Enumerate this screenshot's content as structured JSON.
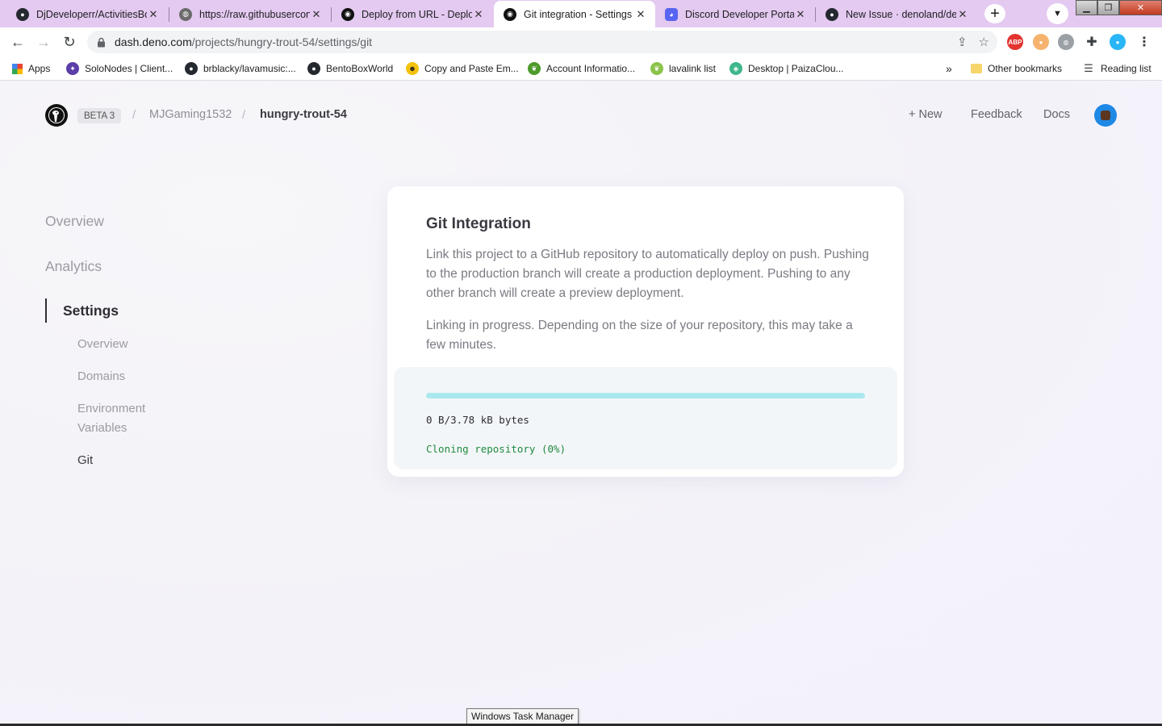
{
  "browser": {
    "tabs": [
      {
        "title": "DjDeveloperr/ActivitiesBo",
        "icon": "github-icon"
      },
      {
        "title": "https://raw.githubusercon",
        "icon": "globe-icon"
      },
      {
        "title": "Deploy from URL - Deplo",
        "icon": "deno-icon"
      },
      {
        "title": "Git integration - Settings",
        "icon": "deno-icon",
        "active": true
      },
      {
        "title": "Discord Developer Portal",
        "icon": "discord-icon"
      },
      {
        "title": "New Issue · denoland/der",
        "icon": "github-icon"
      }
    ],
    "url_domain": "dash.deno.com",
    "url_path": "/projects/hungry-trout-54/settings/git",
    "bookmarks": [
      {
        "label": "Apps",
        "icon": "apps-grid-icon"
      },
      {
        "label": "SoloNodes | Client...",
        "icon": "solonodes-icon"
      },
      {
        "label": "brblacky/lavamusic:...",
        "icon": "github-icon"
      },
      {
        "label": "BentoBoxWorld",
        "icon": "github-icon"
      },
      {
        "label": "Copy and Paste Em...",
        "icon": "emoji-icon"
      },
      {
        "label": "Account Informatio...",
        "icon": "leaf-icon"
      },
      {
        "label": "lavalink list",
        "icon": "leaf-icon"
      },
      {
        "label": "Desktop | PaizaClou...",
        "icon": "cube-icon"
      }
    ],
    "bookmarks_overflow": "»",
    "other_bookmarks": "Other bookmarks",
    "reading_list": "Reading list"
  },
  "header": {
    "badge": "BETA 3",
    "separator": "/",
    "user": "MJGaming1532",
    "project": "hungry-trout-54",
    "new_label": "+  New",
    "feedback_label": "Feedback",
    "docs_label": "Docs"
  },
  "sidebar": {
    "items": [
      "Overview",
      "Analytics"
    ],
    "active": "Settings",
    "sub_items": [
      "Overview",
      "Domains",
      "Environment Variables",
      "Git"
    ],
    "current_sub": "Git"
  },
  "card": {
    "title": "Git Integration",
    "description": "Link this project to a GitHub repository to automatically deploy on push. Pushing to the production branch will create a production deployment. Pushing to any other branch will create a preview deployment.",
    "progress_text": "Linking in progress. Depending on the size of your repository, this may take a few minutes.",
    "bytes": "0 B/3.78 kB bytes",
    "status": "Cloning repository (0%)",
    "progress_fraction": 1.0,
    "accent_color": "#a9e9ee",
    "status_color": "#1f8a3f"
  },
  "taskbar_tooltip": "Windows Task Manager"
}
